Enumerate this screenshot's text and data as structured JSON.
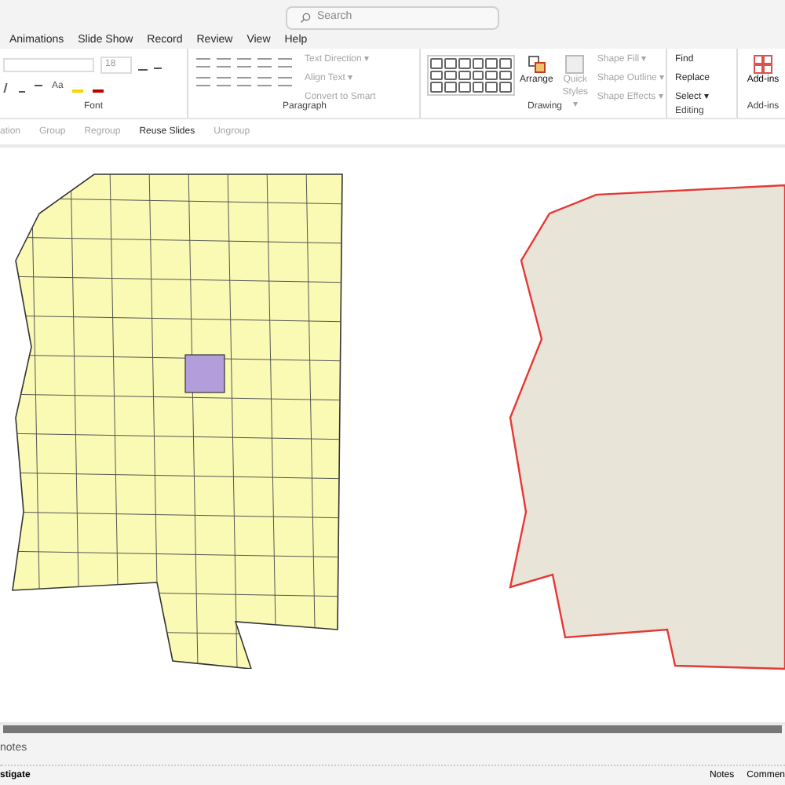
{
  "search": {
    "placeholder": "Search"
  },
  "menu_tabs": [
    {
      "label": "Animations",
      "selected": false
    },
    {
      "label": "Slide Show",
      "selected": false
    },
    {
      "label": "Record",
      "selected": false
    },
    {
      "label": "Review",
      "selected": false
    },
    {
      "label": "View",
      "selected": false
    },
    {
      "label": "Help",
      "selected": false
    }
  ],
  "ribbon": {
    "font": {
      "size": "18",
      "case_button": "Aa",
      "label": "Font"
    },
    "paragraph": {
      "commands": [
        {
          "label": "Text Direction ▾",
          "disabled": true
        },
        {
          "label": "Align Text ▾",
          "disabled": true
        },
        {
          "label": "Convert to Smart",
          "disabled": true
        }
      ],
      "label": "Paragraph"
    },
    "drawing": {
      "arrange": "Arrange",
      "quick_styles": {
        "label": "Quick Styles ▾",
        "disabled": true
      },
      "commands": [
        {
          "label": "Shape Fill ▾",
          "disabled": true
        },
        {
          "label": "Shape Outline ▾",
          "disabled": true
        },
        {
          "label": "Shape Effects ▾",
          "disabled": true
        }
      ],
      "label": "Drawing"
    },
    "editing": {
      "commands": [
        {
          "label": "Find",
          "disabled": false
        },
        {
          "label": "Replace",
          "disabled": false
        },
        {
          "label": "Select ▾",
          "disabled": false
        }
      ],
      "label": "Editing"
    },
    "addins": {
      "button": "Add-ins",
      "label": "Add-ins"
    }
  },
  "quick_toolbar": [
    {
      "label": "ation",
      "disabled": true
    },
    {
      "label": "Group",
      "disabled": true
    },
    {
      "label": "Regroup",
      "disabled": true
    },
    {
      "label": "Reuse Slides",
      "disabled": false
    },
    {
      "label": "Ungroup",
      "disabled": true
    }
  ],
  "notes_placeholder": "notes",
  "status_bar": {
    "accessibility": "stigate",
    "notes": "Notes",
    "comments": "Commen"
  }
}
